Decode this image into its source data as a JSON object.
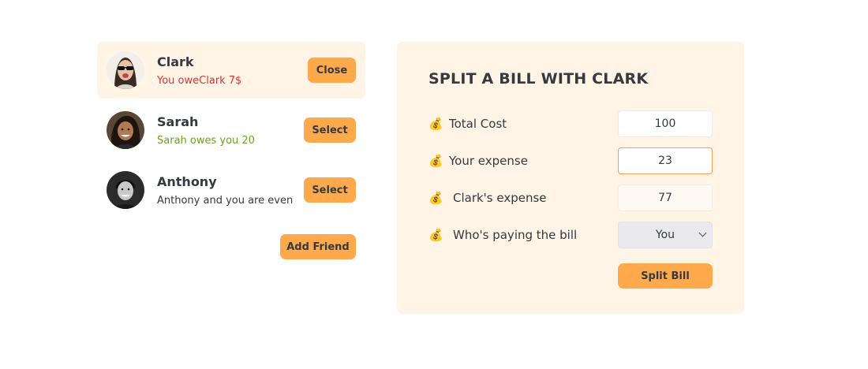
{
  "friends": [
    {
      "name": "Clark",
      "status": "You oweClark 7$",
      "status_color": "#e03131",
      "button": "Close",
      "selected": true
    },
    {
      "name": "Sarah",
      "status": "Sarah owes you 20",
      "status_color": "#66a80f",
      "button": "Select",
      "selected": false
    },
    {
      "name": "Anthony",
      "status": "Anthony and you are even",
      "status_color": "#343a40",
      "button": "Select",
      "selected": false
    }
  ],
  "add_friend_label": "Add Friend",
  "form": {
    "title": "SPLIT A BILL WITH CLARK",
    "emoji": "💰",
    "total_cost_label": "Total Cost",
    "total_cost_value": "100",
    "your_expense_label": "Your expense",
    "your_expense_value": "23",
    "friend_expense_label": "Clark's expense",
    "friend_expense_value": "77",
    "payer_label": "Who's paying the bill",
    "payer_value": "You",
    "submit_label": "Split Bill"
  },
  "colors": {
    "accent": "#ffa94d",
    "panel_bg": "#fff4e6",
    "owe": "#e03131",
    "owed": "#66a80f"
  },
  "icons": {
    "money_bag": "money-bag-icon",
    "dropdown": "chevron-down-icon"
  }
}
